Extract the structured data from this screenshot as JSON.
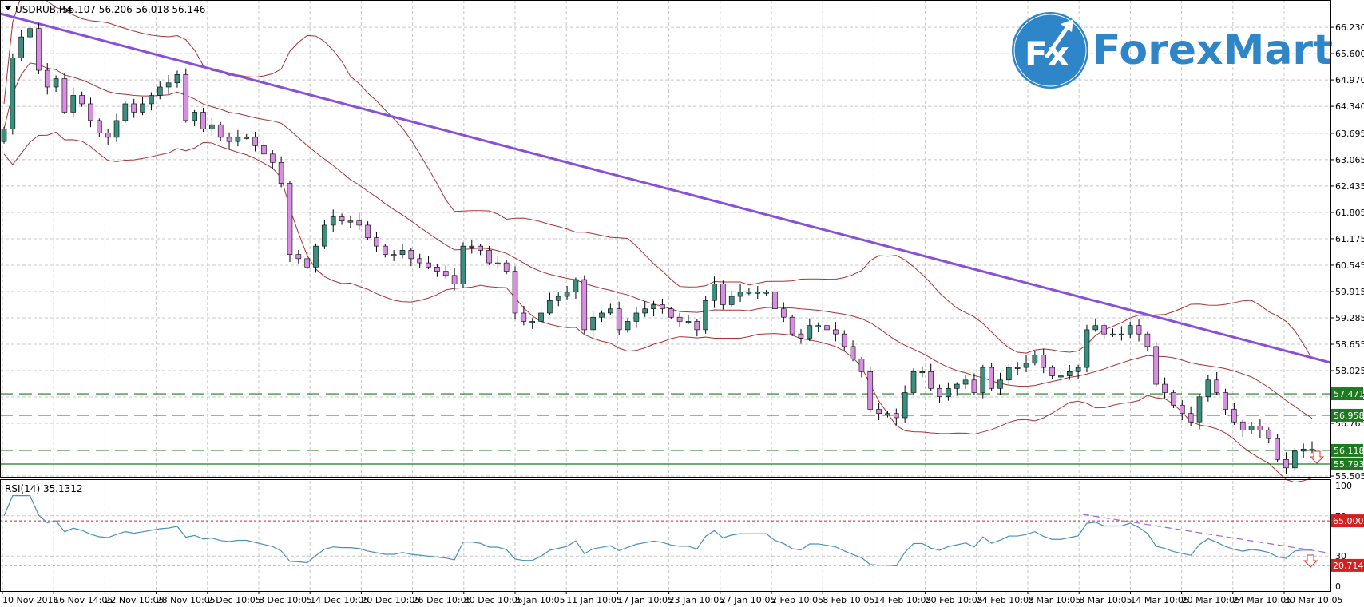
{
  "header": {
    "symbol": "USDRUB,H4",
    "ohlc": "56.107 56.206 56.018 56.146"
  },
  "logo": {
    "mark": "Fx",
    "text": "ForexMart",
    "color": "#2e86c9"
  },
  "price_axis": [
    "66.230",
    "65.600",
    "64.970",
    "64.340",
    "63.695",
    "63.065",
    "62.435",
    "61.805",
    "61.175",
    "60.545",
    "59.915",
    "59.285",
    "58.655",
    "58.025",
    "57.395",
    "56.765",
    "55.505"
  ],
  "levels": [
    {
      "value": 57.471,
      "label": "57.471",
      "style": "dashed"
    },
    {
      "value": 56.958,
      "label": "56.958",
      "style": "dashed"
    },
    {
      "value": 56.118,
      "label": "56.118",
      "style": "dashed"
    },
    {
      "value": 55.793,
      "label": "55.793",
      "style": "solid"
    }
  ],
  "rsi": {
    "label": "RSI(14) 35.1312",
    "axis": [
      "100",
      "70",
      "30",
      "0"
    ],
    "levels": [
      {
        "value": 65,
        "label": "65.0000"
      },
      {
        "value": 20.7143,
        "label": "20.7143"
      }
    ]
  },
  "time_axis": [
    "10 Nov 2016",
    "16 Nov 14:05",
    "22 Nov 10:05",
    "28 Nov 10:05",
    "2 Dec 10:05",
    "8 Dec 10:05",
    "14 Dec 10:05",
    "20 Dec 10:05",
    "26 Dec 10:05",
    "30 Dec 10:05",
    "5 Jan 10:05",
    "11 Jan 10:05",
    "17 Jan 10:05",
    "23 Jan 10:05",
    "27 Jan 10:05",
    "2 Feb 10:05",
    "8 Feb 10:05",
    "14 Feb 10:05",
    "20 Feb 10:05",
    "24 Feb 10:05",
    "2 Mar 10:05",
    "8 Mar 10:05",
    "14 Mar 10:05",
    "20 Mar 10:05",
    "24 Mar 10:05",
    "30 Mar 10:05"
  ],
  "colors": {
    "bull": "#3a8f7f",
    "bear": "#d88fe3",
    "bands": "#a83232",
    "trendline": "#8a4fd8",
    "rsi": "#4a90b8",
    "level": "#1e7a1e",
    "rsi_level": "#d42020"
  },
  "chart_data": {
    "type": "candlestick",
    "title": "USDRUB,H4",
    "ylim": [
      55.505,
      66.23
    ],
    "closes": [
      63.8,
      65.5,
      66.0,
      66.2,
      65.2,
      64.8,
      65.0,
      64.2,
      64.6,
      64.4,
      64.0,
      63.7,
      63.6,
      64.0,
      64.4,
      64.2,
      64.4,
      64.6,
      64.8,
      64.9,
      65.1,
      64.0,
      64.2,
      63.8,
      63.9,
      63.6,
      63.5,
      63.6,
      63.6,
      63.4,
      63.2,
      63.0,
      62.5,
      60.8,
      60.7,
      60.5,
      61.0,
      61.5,
      61.7,
      61.6,
      61.6,
      61.5,
      61.2,
      61.0,
      60.8,
      60.8,
      60.9,
      60.7,
      60.6,
      60.5,
      60.4,
      60.3,
      60.1,
      61.0,
      61.0,
      60.9,
      60.6,
      60.6,
      60.4,
      59.4,
      59.2,
      59.2,
      59.4,
      59.7,
      59.8,
      59.9,
      60.2,
      59.0,
      59.3,
      59.4,
      59.5,
      59.0,
      59.2,
      59.4,
      59.5,
      59.6,
      59.5,
      59.3,
      59.2,
      59.2,
      59.0,
      59.7,
      60.1,
      59.6,
      59.8,
      59.9,
      59.9,
      59.9,
      59.9,
      59.5,
      59.3,
      58.9,
      58.8,
      59.1,
      59.1,
      59.0,
      58.9,
      58.6,
      58.3,
      58.0,
      57.1,
      57.0,
      57.0,
      56.9,
      57.5,
      58.0,
      58.0,
      57.6,
      57.4,
      57.6,
      57.7,
      57.8,
      57.5,
      58.1,
      57.6,
      57.8,
      58.1,
      58.1,
      58.2,
      58.4,
      58.1,
      57.9,
      57.9,
      58.0,
      58.1,
      59.0,
      59.1,
      58.9,
      58.9,
      58.9,
      59.1,
      58.9,
      58.6,
      57.7,
      57.5,
      57.2,
      57.0,
      56.8,
      57.4,
      57.8,
      57.5,
      57.1,
      56.8,
      56.6,
      56.7,
      56.6,
      56.4,
      55.9,
      55.7,
      56.1,
      56.15,
      56.146
    ],
    "indicators": [
      "Bollinger Bands(20,2)",
      "RSI(14)"
    ],
    "trendline": {
      "from": 66.6,
      "to": 58.2
    }
  }
}
